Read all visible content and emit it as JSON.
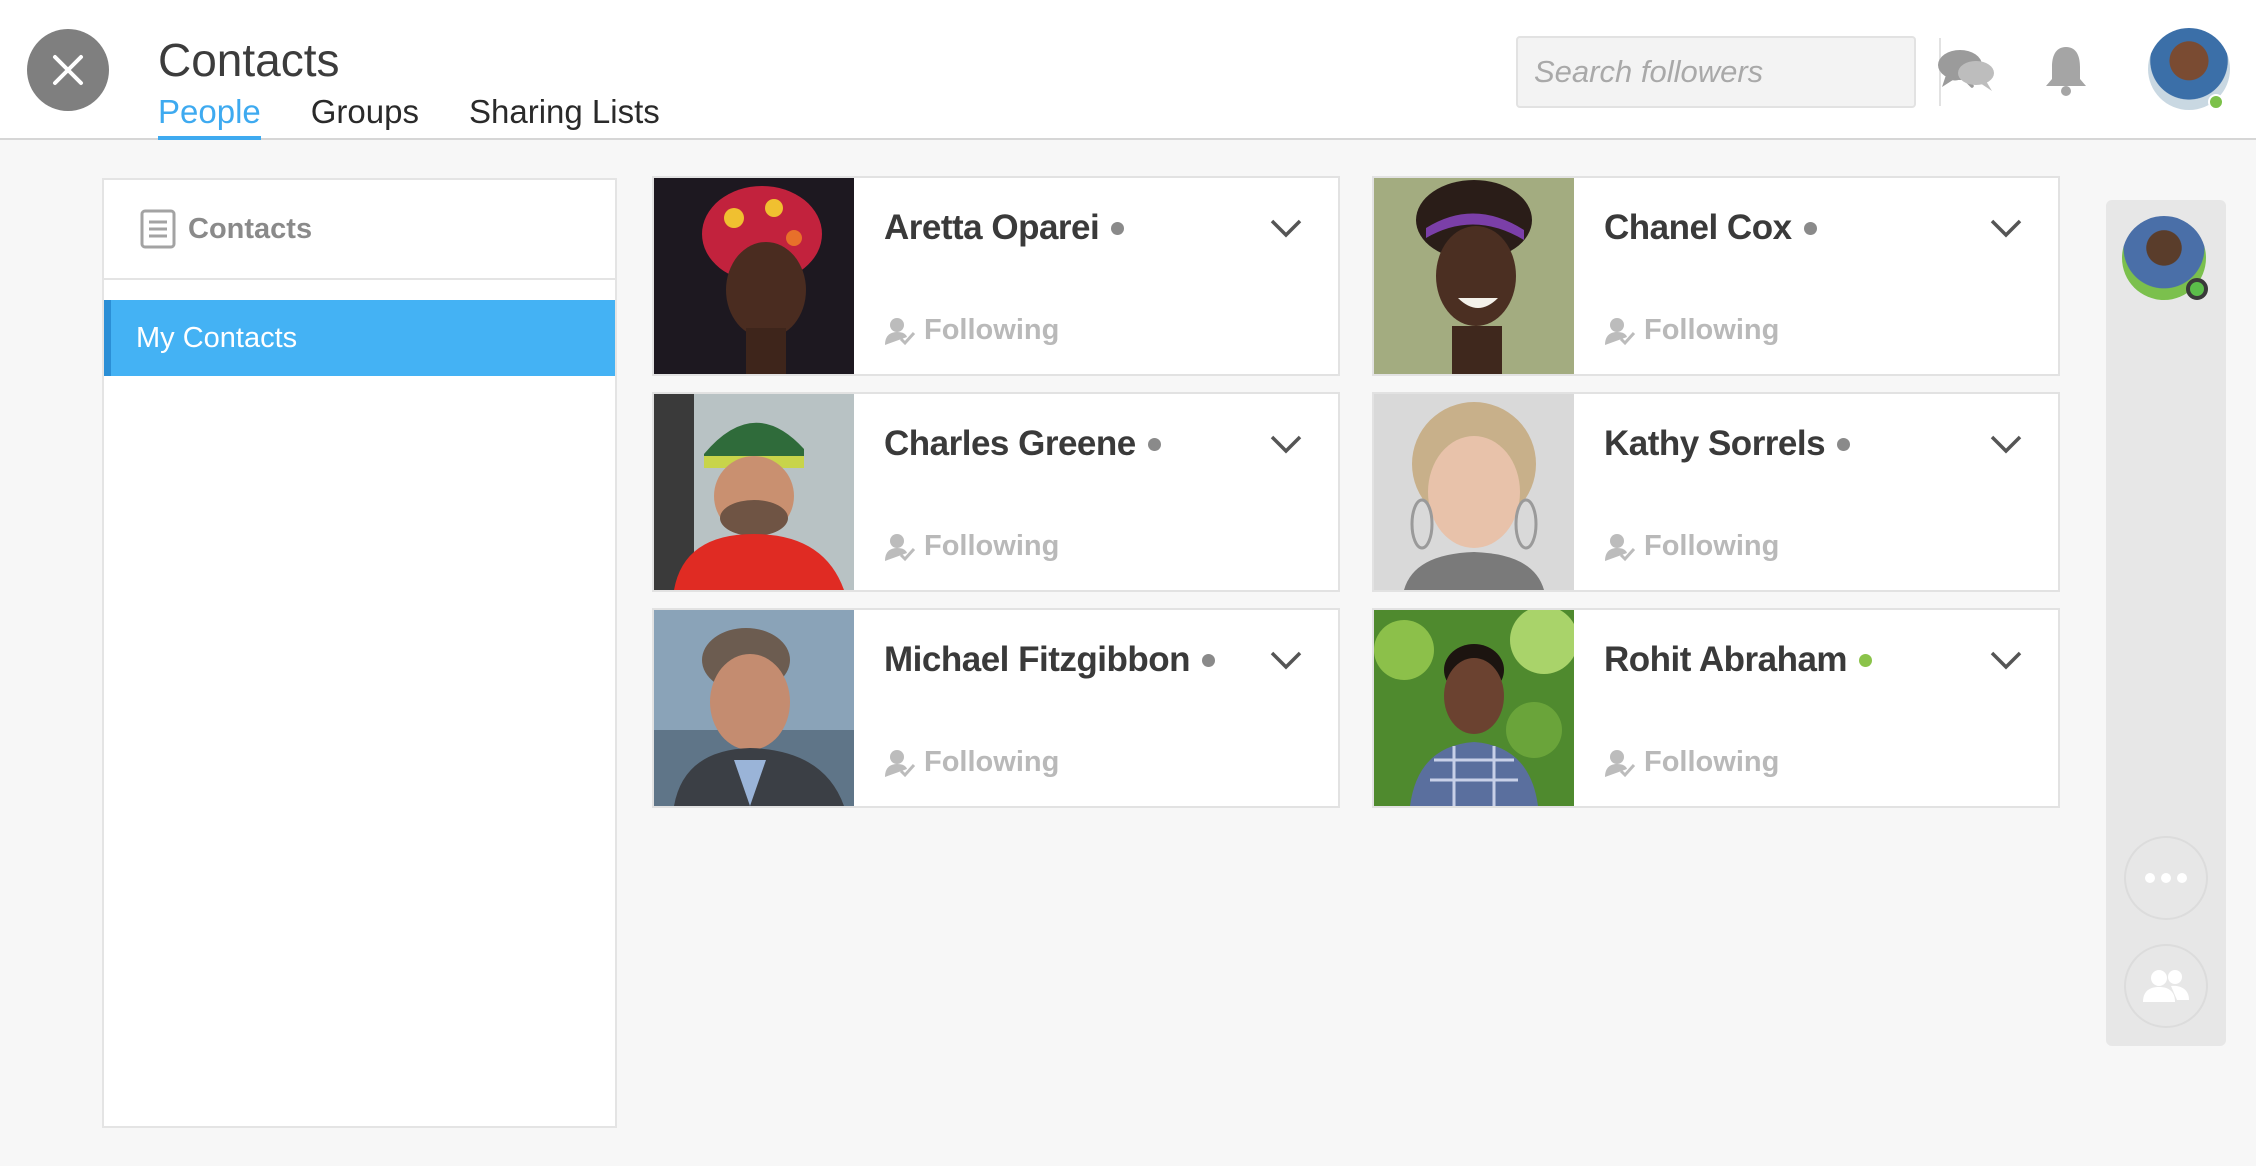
{
  "header": {
    "title": "Contacts",
    "tabs": [
      {
        "label": "People",
        "active": true
      },
      {
        "label": "Groups",
        "active": false
      },
      {
        "label": "Sharing Lists",
        "active": false
      }
    ],
    "search_placeholder": "Search followers",
    "accent_color": "#3eaaf0"
  },
  "sidebar": {
    "title": "Contacts",
    "items": [
      {
        "label": "My Contacts",
        "selected": true
      }
    ]
  },
  "contacts": [
    {
      "name": "Aretta Oparei",
      "status": "offline",
      "relation": "Following"
    },
    {
      "name": "Chanel Cox",
      "status": "offline",
      "relation": "Following"
    },
    {
      "name": "Charles Greene",
      "status": "offline",
      "relation": "Following"
    },
    {
      "name": "Kathy Sorrels",
      "status": "offline",
      "relation": "Following"
    },
    {
      "name": "Michael Fitzgibbon",
      "status": "offline",
      "relation": "Following"
    },
    {
      "name": "Rohit Abraham",
      "status": "online",
      "relation": "Following"
    }
  ],
  "icons": {
    "close": "close-icon",
    "search": "search-icon",
    "chat": "chat-bubbles-icon",
    "notifications": "bell-icon",
    "sidebar": "list-document-icon",
    "expand": "chevron-down-icon",
    "following": "user-check-icon",
    "more": "more-dots-icon",
    "people": "people-icon"
  },
  "colors": {
    "online": "#8bc34a",
    "offline": "#8a8a8a",
    "selected_bg": "#44b2f4"
  }
}
